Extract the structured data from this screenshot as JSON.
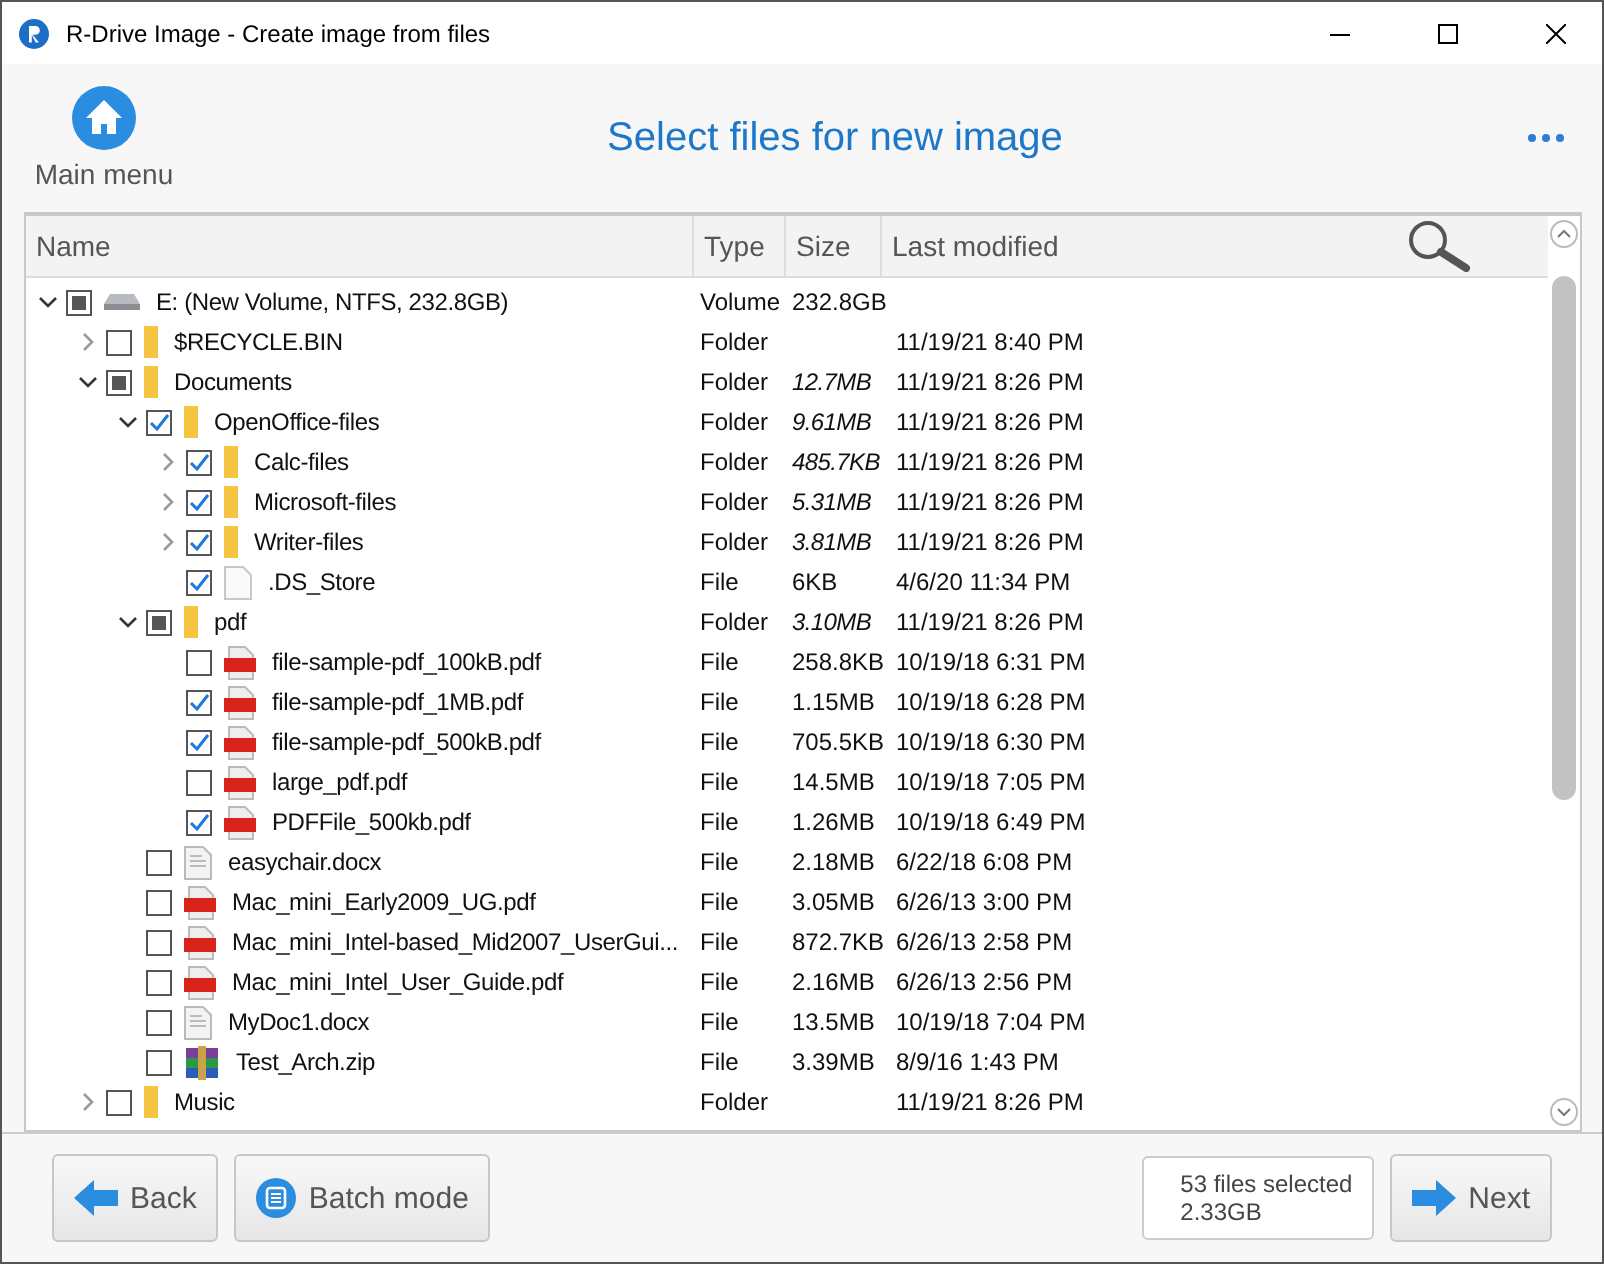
{
  "window": {
    "title": "R-Drive Image - Create image from files"
  },
  "header": {
    "home_label": "Main menu",
    "title": "Select files for new image"
  },
  "table": {
    "columns": [
      "Name",
      "Type",
      "Size",
      "Last modified"
    ],
    "rows": [
      {
        "name": "E: (New Volume, NTFS, 232.8GB)",
        "kind": "volume",
        "type": "Volume",
        "size": "232.8GB",
        "size_calculated": false,
        "checked": false,
        "partial": true,
        "expanded": true,
        "children": [
          {
            "name": "$RECYCLE.BIN",
            "kind": "folder",
            "type": "Folder",
            "modified": "11/19/21 8:40 PM",
            "checked": false,
            "partial": false,
            "expanded": false
          },
          {
            "name": "Documents",
            "kind": "folder",
            "type": "Folder",
            "size": "12.7MB",
            "size_calculated": true,
            "modified": "11/19/21 8:26 PM",
            "checked": false,
            "partial": true,
            "expanded": true,
            "children": [
              {
                "name": "OpenOffice-files",
                "kind": "folder",
                "type": "Folder",
                "size": "9.61MB",
                "size_calculated": true,
                "modified": "11/19/21 8:26 PM",
                "checked": true,
                "partial": false,
                "expanded": true,
                "children": [
                  {
                    "name": "Calc-files",
                    "kind": "folder",
                    "type": "Folder",
                    "size": "485.7KB",
                    "size_calculated": true,
                    "modified": "11/19/21 8:26 PM",
                    "checked": true,
                    "partial": false,
                    "expanded": false
                  },
                  {
                    "name": "Microsoft-files",
                    "kind": "folder",
                    "type": "Folder",
                    "size": "5.31MB",
                    "size_calculated": true,
                    "modified": "11/19/21 8:26 PM",
                    "checked": true,
                    "partial": false,
                    "expanded": false
                  },
                  {
                    "name": "Writer-files",
                    "kind": "folder",
                    "type": "Folder",
                    "size": "3.81MB",
                    "size_calculated": true,
                    "modified": "11/19/21 8:26 PM",
                    "checked": true,
                    "partial": false,
                    "expanded": false
                  },
                  {
                    "name": ".DS_Store",
                    "kind": "file",
                    "type": "File",
                    "size": "6KB",
                    "size_calculated": false,
                    "modified": "4/6/20 11:34 PM",
                    "checked": true,
                    "partial": false
                  }
                ]
              },
              {
                "name": "pdf",
                "kind": "folder",
                "type": "Folder",
                "size": "3.10MB",
                "size_calculated": true,
                "modified": "11/19/21 8:26 PM",
                "checked": false,
                "partial": true,
                "expanded": true,
                "children": [
                  {
                    "name": "file-sample-pdf_100kB.pdf",
                    "kind": "pdf",
                    "type": "File",
                    "size": "258.8KB",
                    "size_calculated": false,
                    "modified": "10/19/18 6:31 PM",
                    "checked": false,
                    "partial": false
                  },
                  {
                    "name": "file-sample-pdf_1MB.pdf",
                    "kind": "pdf",
                    "type": "File",
                    "size": "1.15MB",
                    "size_calculated": false,
                    "modified": "10/19/18 6:28 PM",
                    "checked": true,
                    "partial": false
                  },
                  {
                    "name": "file-sample-pdf_500kB.pdf",
                    "kind": "pdf",
                    "type": "File",
                    "size": "705.5KB",
                    "size_calculated": false,
                    "modified": "10/19/18 6:30 PM",
                    "checked": true,
                    "partial": false
                  },
                  {
                    "name": "large_pdf.pdf",
                    "kind": "pdf",
                    "type": "File",
                    "size": "14.5MB",
                    "size_calculated": false,
                    "modified": "10/19/18 7:05 PM",
                    "checked": false,
                    "partial": false
                  },
                  {
                    "name": "PDFFile_500kb.pdf",
                    "kind": "pdf",
                    "type": "File",
                    "size": "1.26MB",
                    "size_calculated": false,
                    "modified": "10/19/18 6:49 PM",
                    "checked": true,
                    "partial": false
                  }
                ]
              },
              {
                "name": "easychair.docx",
                "kind": "docx",
                "type": "File",
                "size": "2.18MB",
                "size_calculated": false,
                "modified": "6/22/18 6:08 PM",
                "checked": false,
                "partial": false
              },
              {
                "name": "Mac_mini_Early2009_UG.pdf",
                "kind": "pdf",
                "type": "File",
                "size": "3.05MB",
                "size_calculated": false,
                "modified": "6/26/13 3:00 PM",
                "checked": false,
                "partial": false
              },
              {
                "name": "Mac_mini_Intel-based_Mid2007_UserGui...",
                "kind": "pdf",
                "type": "File",
                "size": "872.7KB",
                "size_calculated": false,
                "modified": "6/26/13 2:58 PM",
                "checked": false,
                "partial": false
              },
              {
                "name": "Mac_mini_Intel_User_Guide.pdf",
                "kind": "pdf",
                "type": "File",
                "size": "2.16MB",
                "size_calculated": false,
                "modified": "6/26/13 2:56 PM",
                "checked": false,
                "partial": false
              },
              {
                "name": "MyDoc1.docx",
                "kind": "docx",
                "type": "File",
                "size": "13.5MB",
                "size_calculated": false,
                "modified": "10/19/18 7:04 PM",
                "checked": false,
                "partial": false
              },
              {
                "name": "Test_Arch.zip",
                "kind": "zip",
                "type": "File",
                "size": "3.39MB",
                "size_calculated": false,
                "modified": "8/9/16 1:43 PM",
                "checked": false,
                "partial": false
              }
            ]
          },
          {
            "name": "Music",
            "kind": "folder",
            "type": "Folder",
            "modified": "11/19/21 8:26 PM",
            "checked": false,
            "partial": false,
            "expanded": false
          }
        ]
      }
    ]
  },
  "footer": {
    "back": "Back",
    "batch": "Batch mode",
    "selection_count": "53 files selected",
    "selection_size": "2.33GB",
    "next": "Next"
  }
}
